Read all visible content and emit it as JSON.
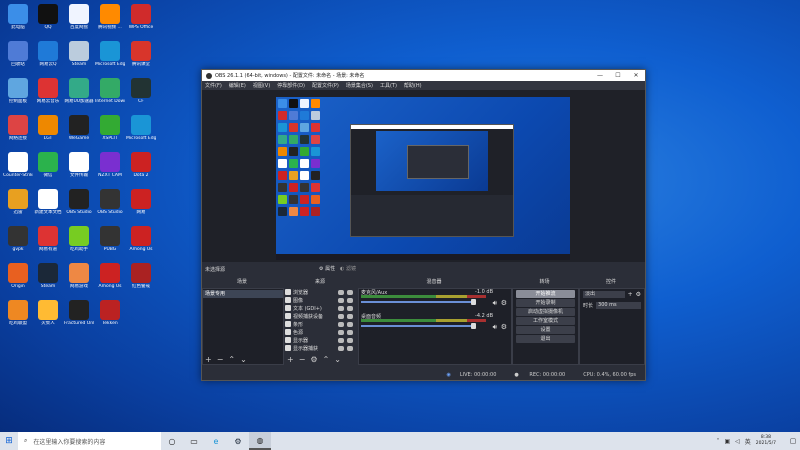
{
  "desktop": {
    "icons": [
      {
        "label": "此电脑",
        "color": "#3b8ee8"
      },
      {
        "label": "QQ",
        "color": "#111"
      },
      {
        "label": "百度网盘",
        "color": "#f0f4ff"
      },
      {
        "label": "腾讯视频 ...",
        "color": "#ff8a00"
      },
      {
        "label": "WPS Office",
        "color": "#d02b2b"
      },
      {
        "label": "回收站",
        "color": "#4f7bd6"
      },
      {
        "label": "网易云Q",
        "color": "#1f7ad8"
      },
      {
        "label": "Steam",
        "color": "#bcd"
      },
      {
        "label": "Microsoft Edge",
        "color": "#1a95d6"
      },
      {
        "label": "腾讯课堂",
        "color": "#d8352b"
      },
      {
        "label": "控制面板",
        "color": "#5fa6e0"
      },
      {
        "label": "网易云音乐",
        "color": "#d33"
      },
      {
        "label": "网易UU加速器",
        "color": "#3a8"
      },
      {
        "label": "Internet Downlo...",
        "color": "#3a6"
      },
      {
        "label": "CF",
        "color": "#233"
      },
      {
        "label": "网络连接",
        "color": "#d44"
      },
      {
        "label": "LGT",
        "color": "#e80"
      },
      {
        "label": "WeGame",
        "color": "#222"
      },
      {
        "label": "XSPLIT",
        "color": "#3a3"
      },
      {
        "label": "Microsoft Edge",
        "color": "#1a95d6"
      },
      {
        "label": "Counter-Strike Global",
        "color": "#fff"
      },
      {
        "label": "微信",
        "color": "#2bb24c"
      },
      {
        "label": "文件传输",
        "color": "#fff"
      },
      {
        "label": "NZXT CAM",
        "color": "#7a2fd0"
      },
      {
        "label": "Dota 2",
        "color": "#c22"
      },
      {
        "label": "迅雷",
        "color": "#e8a020"
      },
      {
        "label": "新建文本文档",
        "color": "#fff"
      },
      {
        "label": "OBS Studio",
        "color": "#222"
      },
      {
        "label": "OBS Studio",
        "color": "#333"
      },
      {
        "label": "网易",
        "color": "#c22"
      },
      {
        "label": "gvpk",
        "color": "#333"
      },
      {
        "label": "网易有道",
        "color": "#d33"
      },
      {
        "label": "吃鸡助手",
        "color": "#7c2"
      },
      {
        "label": "PUBG",
        "color": "#333"
      },
      {
        "label": "Among Us",
        "color": "#c22"
      },
      {
        "label": "Origin",
        "color": "#e86020"
      },
      {
        "label": "Steam",
        "color": "#1b2838"
      },
      {
        "label": "网易游戏",
        "color": "#e84"
      },
      {
        "label": "Among Us",
        "color": "#c22"
      },
      {
        "label": "红色警戒",
        "color": "#a22"
      },
      {
        "label": "吃鸡联盟",
        "color": "#e82"
      },
      {
        "label": "火柴人",
        "color": "#fb3"
      },
      {
        "label": "Fractured Online",
        "color": "#222"
      },
      {
        "label": "Tekken",
        "color": "#b22"
      }
    ]
  },
  "obs": {
    "title": "OBS 26.1.1 (64-bit, windows) - 配置文件: 未命名 - 场景: 未命名",
    "menu": [
      "文件(F)",
      "编辑(E)",
      "视图(V)",
      "停靠部件(D)",
      "配置文件(P)",
      "场景集合(S)",
      "工具(T)",
      "帮助(H)"
    ],
    "scene_label": "未选择源",
    "properties_label": "属性",
    "filters_label": "滤镜",
    "docks": {
      "scenes": "场景",
      "sources": "来源",
      "mixer": "混音器",
      "transitions": "转场",
      "controls": "控件"
    },
    "scenes": [
      "场景专用"
    ],
    "sources": [
      "浏览器",
      "图像",
      "文本 (GDI+)",
      "视频捕获设备",
      "条形",
      "色源",
      "显示器",
      "显示器捕获"
    ],
    "mixer": [
      {
        "name": "麦克风/Aux",
        "db": "-1.0 dB"
      },
      {
        "name": "桌面音频",
        "db": "-4.2 dB"
      }
    ],
    "transition": {
      "type": "淡出",
      "duration_label": "时长",
      "duration": "300 ms"
    },
    "controls": [
      "开始推流",
      "开始录制",
      "启动虚拟摄像机",
      "工作室模式",
      "设置",
      "退出"
    ],
    "status": {
      "live": "LIVE: 00:00:00",
      "rec": "REC: 00:00:00",
      "cpu": "CPU: 0.4%, 60.00 fps"
    }
  },
  "taskbar": {
    "search_placeholder": "在这里输入你要搜索的内容",
    "time": "8:38",
    "date": "2021/5/7"
  }
}
